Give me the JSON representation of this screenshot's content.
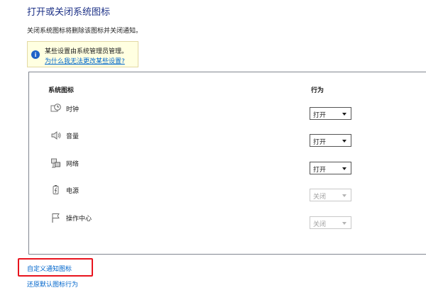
{
  "header": {
    "title": "打开或关闭系统图标",
    "description": "关闭系统图标将删除该图标并关闭通知。"
  },
  "info_bar": {
    "icon": "info-icon",
    "icon_glyph": "i",
    "text": "某些设置由系统管理员管理。",
    "link": "为什么我无法更改某些设置?"
  },
  "table": {
    "col_icon": "系统图标",
    "col_behavior": "行为",
    "rows": [
      {
        "label": "时钟",
        "icon": "clock-icon",
        "value": "打开",
        "enabled": true
      },
      {
        "label": "音量",
        "icon": "volume-icon",
        "value": "打开",
        "enabled": true
      },
      {
        "label": "网络",
        "icon": "network-icon",
        "value": "打开",
        "enabled": true
      },
      {
        "label": "电源",
        "icon": "power-icon",
        "value": "关闭",
        "enabled": false
      },
      {
        "label": "操作中心",
        "icon": "flag-icon",
        "value": "关闭",
        "enabled": false
      }
    ]
  },
  "links": {
    "customize": "自定义通知图标",
    "restore": "还原默认图标行为"
  },
  "colors": {
    "title": "#1e3287",
    "link": "#0066cc",
    "info_bg": "#ffffe1",
    "highlight": "#e8141e"
  }
}
